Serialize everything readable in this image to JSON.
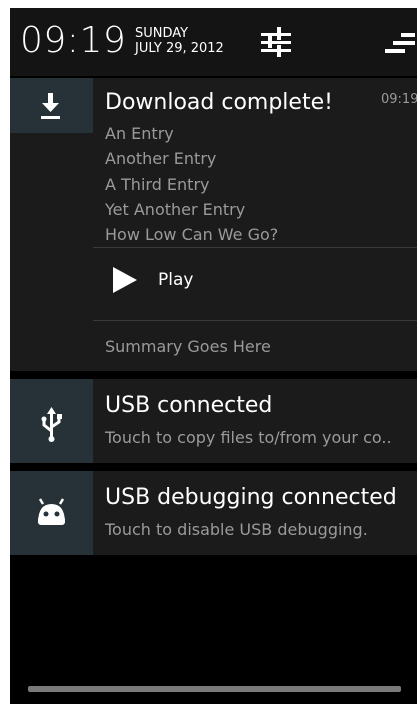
{
  "header": {
    "clock": "09:19",
    "day": "SUNDAY",
    "date": "JULY 29, 2012",
    "settings_icon": "quick-settings-sliders-icon",
    "clear_icon": "clear-all-notifications-icon"
  },
  "notifications": {
    "download": {
      "icon": "download-icon",
      "title": "Download complete!",
      "time": "09:19",
      "lines": [
        "An Entry",
        "Another Entry",
        "A Third Entry",
        "Yet Another Entry",
        "How Low Can We Go?"
      ],
      "action_label": "Play",
      "summary": "Summary Goes Here"
    },
    "usb": {
      "icon": "usb-icon",
      "title": "USB connected",
      "text": "Touch to copy files to/from your co.."
    },
    "usb_debug": {
      "icon": "android-debug-icon",
      "title": "USB debugging connected",
      "text": "Touch to disable USB debugging."
    }
  },
  "colors": {
    "background": "#000000",
    "card": "#1b1b1b",
    "icon_tile": "#263238",
    "title_text": "#ffffff",
    "secondary_text": "#9a9a9a"
  }
}
